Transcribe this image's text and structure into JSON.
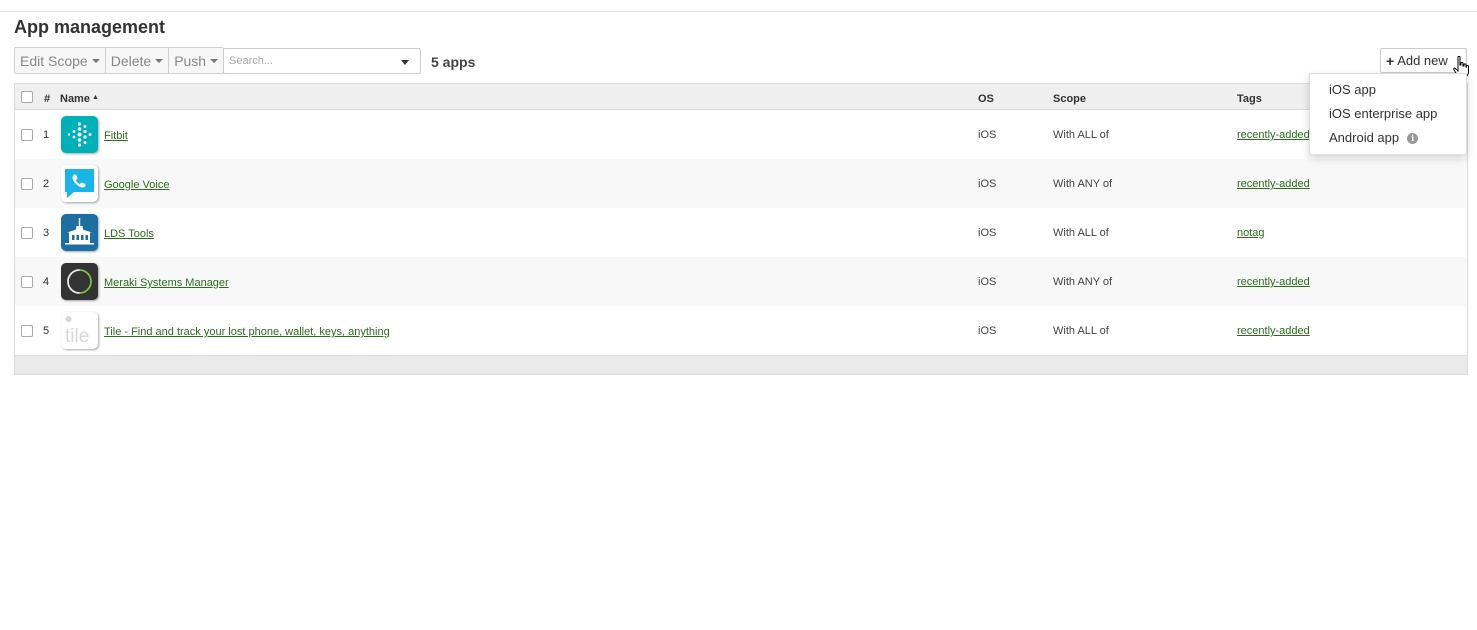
{
  "page": {
    "title": "App management",
    "app_count": "5 apps"
  },
  "toolbar": {
    "edit_scope": "Edit Scope",
    "delete": "Delete",
    "push": "Push",
    "search_placeholder": "Search...",
    "add_new": "Add new"
  },
  "dropdown": {
    "items": [
      "iOS app",
      "iOS enterprise app",
      "Android app"
    ],
    "info_glyph": "i"
  },
  "table": {
    "headers": {
      "num": "#",
      "name": "Name",
      "sort_glyph": "▲",
      "os": "OS",
      "scope": "Scope",
      "tags": "Tags"
    },
    "rows": [
      {
        "num": "1",
        "name": "Fitbit",
        "os": "iOS",
        "scope": "With ALL of",
        "tag": "recently-added",
        "icon": "fitbit-icon"
      },
      {
        "num": "2",
        "name": "Google Voice",
        "os": "iOS",
        "scope": "With ANY of",
        "tag": "recently-added",
        "icon": "google-voice-icon"
      },
      {
        "num": "3",
        "name": "LDS Tools",
        "os": "iOS",
        "scope": "With ALL of",
        "tag": "notag",
        "icon": "lds-tools-icon"
      },
      {
        "num": "4",
        "name": "Meraki Systems Manager",
        "os": "iOS",
        "scope": "With ANY of",
        "tag": "recently-added",
        "icon": "meraki-sm-icon"
      },
      {
        "num": "5",
        "name": "Tile - Find and track your lost phone, wallet, keys, anything",
        "os": "iOS",
        "scope": "With ALL of",
        "tag": "recently-added",
        "icon": "tile-icon",
        "icon_text": "tile"
      }
    ]
  },
  "colors": {
    "link": "#2c6e1e",
    "fitbit": "#00b0b9",
    "google_voice": "#1ab5e8",
    "lds": "#1c6fa0",
    "meraki": "#333333"
  }
}
